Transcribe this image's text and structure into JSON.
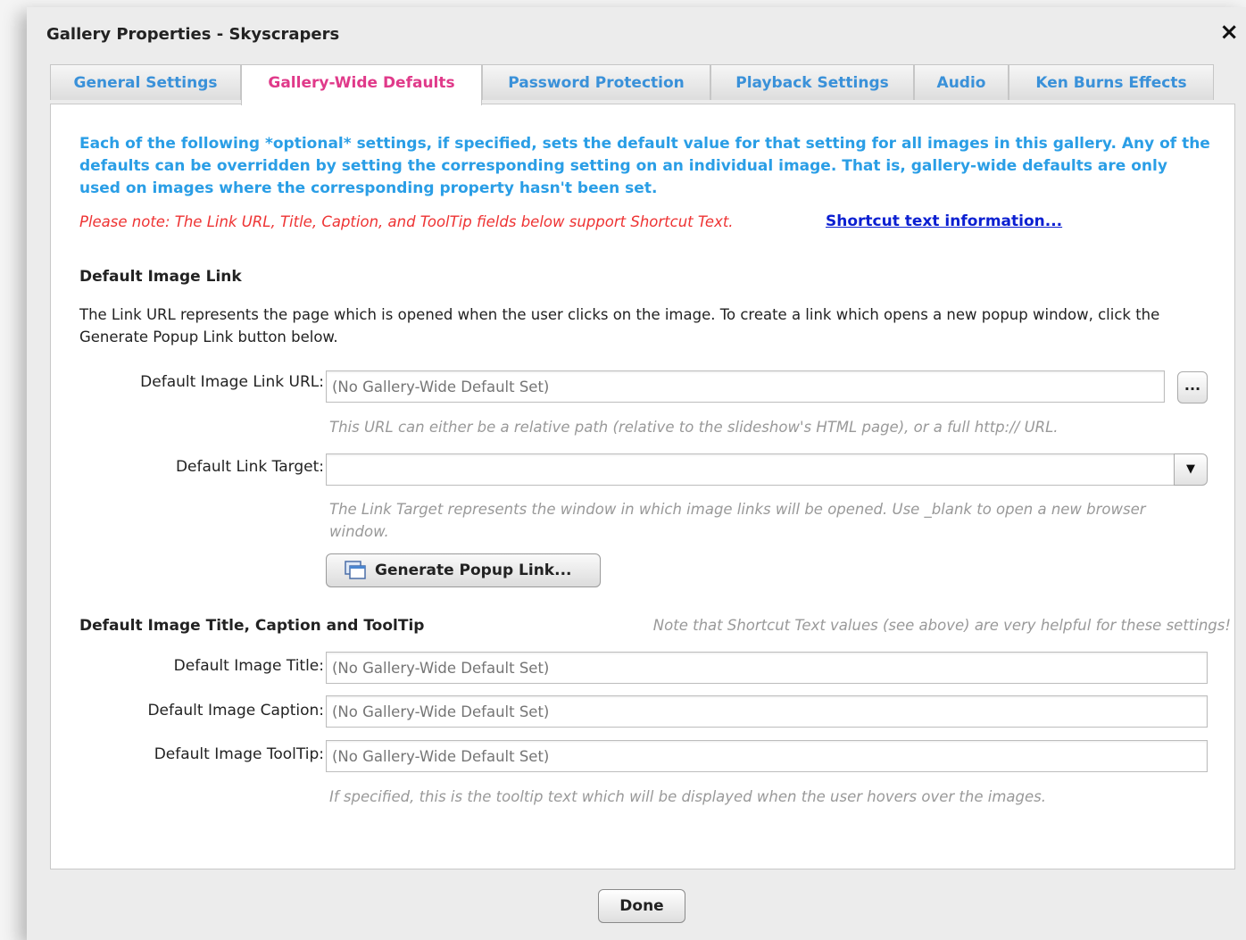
{
  "window": {
    "title": "Gallery Properties - Skyscrapers",
    "close_icon": "×"
  },
  "tabs": [
    {
      "label": "General Settings",
      "active": false
    },
    {
      "label": "Gallery-Wide Defaults",
      "active": true
    },
    {
      "label": "Password Protection",
      "active": false
    },
    {
      "label": "Playback Settings",
      "active": false
    },
    {
      "label": "Audio",
      "active": false
    },
    {
      "label": "Ken Burns Effects",
      "active": false
    }
  ],
  "panel": {
    "intro": "Each of the following *optional* settings, if specified, sets the default value for that setting for all images in this gallery.  Any of the defaults can be overridden by setting the corresponding setting on an individual image.  That is, gallery-wide defaults are only used on images where the corresponding property hasn't been set.",
    "note": "Please note: The Link URL, Title, Caption, and ToolTip fields below support Shortcut Text.",
    "note_link": "Shortcut text information...",
    "link_section": {
      "heading": "Default Image Link",
      "description": "The Link URL represents the page which is opened when the user clicks on the image.  To create a link which opens a new popup window, click the Generate Popup Link button below.",
      "url_label": "Default Image Link URL:",
      "url_placeholder": "(No Gallery-Wide Default Set)",
      "browse_button": "...",
      "url_hint": "This URL can either be a relative path (relative to the slideshow's HTML page), or a full http:// URL.",
      "target_label": "Default Link Target:",
      "target_value": "",
      "dropdown_icon": "▼",
      "target_hint": "The Link Target represents the window in which image links will be opened.  Use _blank to open a new browser window.",
      "popup_button": "Generate Popup Link..."
    },
    "title_section": {
      "heading": "Default Image Title, Caption and ToolTip",
      "side_note": "Note that Shortcut Text values (see above) are very helpful for these settings!",
      "title_label": "Default Image Title:",
      "title_placeholder": "(No Gallery-Wide Default Set)",
      "caption_label": "Default Image Caption:",
      "caption_placeholder": "(No Gallery-Wide Default Set)",
      "tooltip_label": "Default Image ToolTip:",
      "tooltip_placeholder": "(No Gallery-Wide Default Set)",
      "tooltip_hint": "If specified, this is the tooltip text which will be displayed when the user hovers over the images."
    }
  },
  "footer": {
    "done_button": "Done"
  },
  "colors": {
    "intro_text": "#2a9ee6",
    "note_text": "#ee3333",
    "active_tab_text": "#e03a8a",
    "tab_text": "#3a91d9",
    "link": "#0b1fd1"
  }
}
